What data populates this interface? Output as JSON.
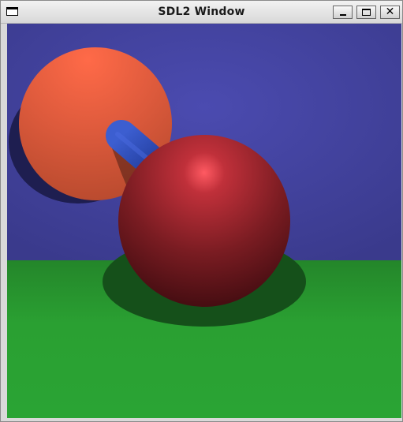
{
  "window": {
    "title": "SDL2 Window",
    "icons": {
      "system_menu": "window-menu-icon",
      "minimize": "minimize-icon",
      "maximize": "maximize-icon",
      "close": "close-icon"
    },
    "close_glyph": "✕"
  },
  "scene": {
    "colors": {
      "sky": "#4a4aa6",
      "ground": "#2a9a2a",
      "orange_sphere": "#e06040",
      "red_sphere": "#8a2024",
      "cylinder": "#2a46a8",
      "shadow": "#1a1a4a"
    }
  }
}
